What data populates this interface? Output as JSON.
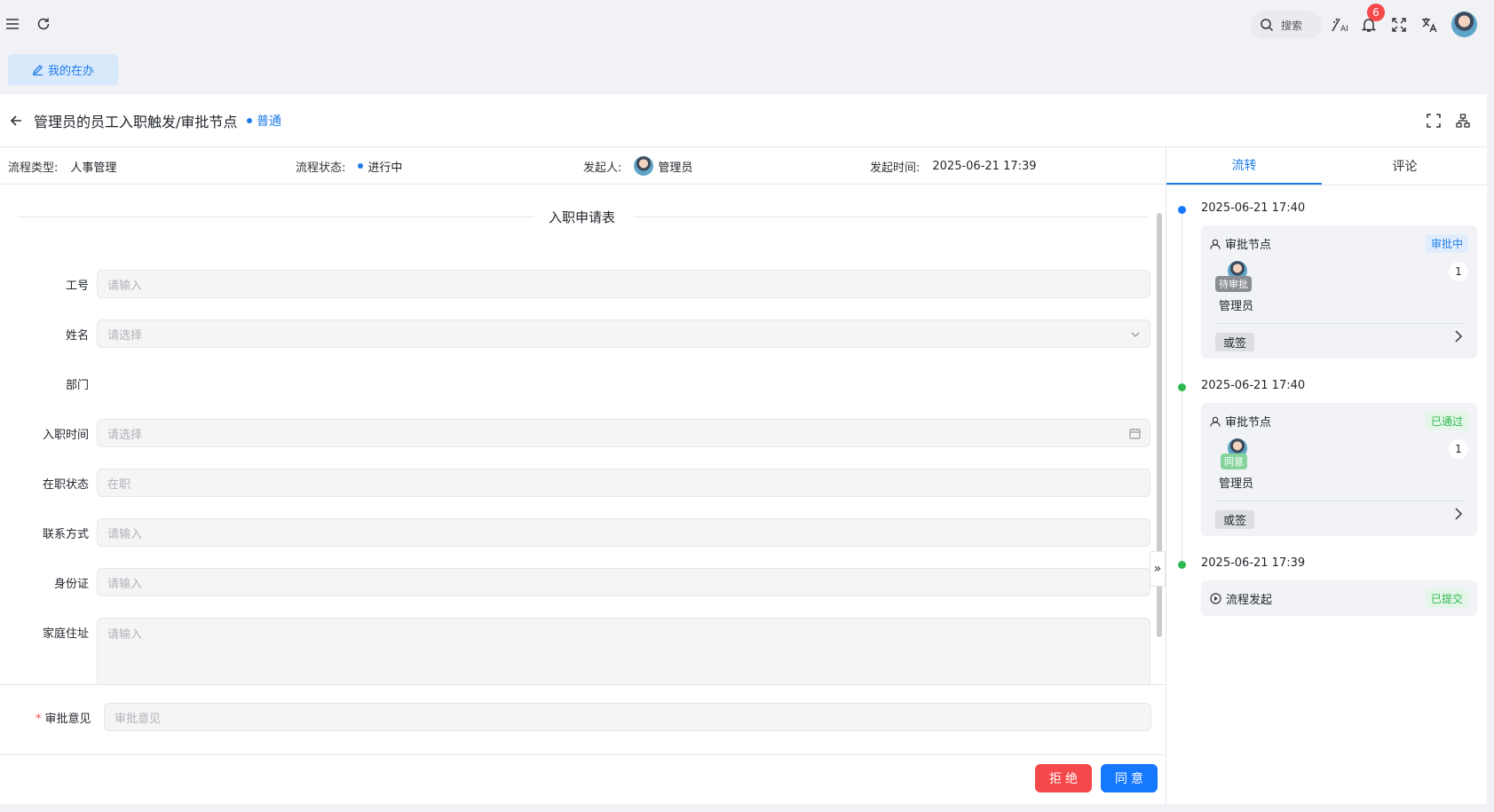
{
  "topbar": {
    "search_placeholder": "搜索",
    "notification_count": "6"
  },
  "tabs": [
    {
      "label": "我的在办"
    }
  ],
  "header": {
    "title": "管理员的员工入职触发/审批节点",
    "priority": "普通"
  },
  "info": {
    "type_label": "流程类型:",
    "type_value": "人事管理",
    "status_label": "流程状态:",
    "status_value": "进行中",
    "initiator_label": "发起人:",
    "initiator_value": "管理员",
    "time_label": "发起时间:",
    "time_value": "2025-06-21 17:39"
  },
  "form": {
    "section_title": "入职申请表",
    "fields": [
      {
        "label": "工号",
        "placeholder": "请输入"
      },
      {
        "label": "姓名",
        "placeholder": "请选择"
      },
      {
        "label": "部门",
        "placeholder": ""
      },
      {
        "label": "入职时间",
        "placeholder": "请选择"
      },
      {
        "label": "在职状态",
        "placeholder": "在职"
      },
      {
        "label": "联系方式",
        "placeholder": "请输入"
      },
      {
        "label": "身份证",
        "placeholder": "请输入"
      },
      {
        "label": "家庭住址",
        "placeholder": "请输入"
      }
    ]
  },
  "opinion": {
    "required_mark": "*",
    "label": "审批意见",
    "placeholder": "审批意见"
  },
  "actions": {
    "reject": "拒绝",
    "agree": "同意"
  },
  "side": {
    "tabs": [
      "流转",
      "评论"
    ],
    "timeline": [
      {
        "time": "2025-06-21 17:40",
        "dot_color": "#1677ff",
        "title": "审批节点",
        "tag": "审批中",
        "user_status": "待审批",
        "user_status_color": "#8a8d93",
        "user_name": "管理员",
        "count": "1",
        "mode": "或签"
      },
      {
        "time": "2025-06-21 17:40",
        "dot_color": "#2fb850",
        "title": "审批节点",
        "tag": "已通过",
        "user_status": "同意",
        "user_status_color": "#86d49c",
        "user_name": "管理员",
        "count": "1",
        "mode": "或签"
      },
      {
        "time": "2025-06-21 17:39",
        "dot_color": "#2fb850",
        "title": "流程发起",
        "tag": "已提交"
      }
    ]
  }
}
